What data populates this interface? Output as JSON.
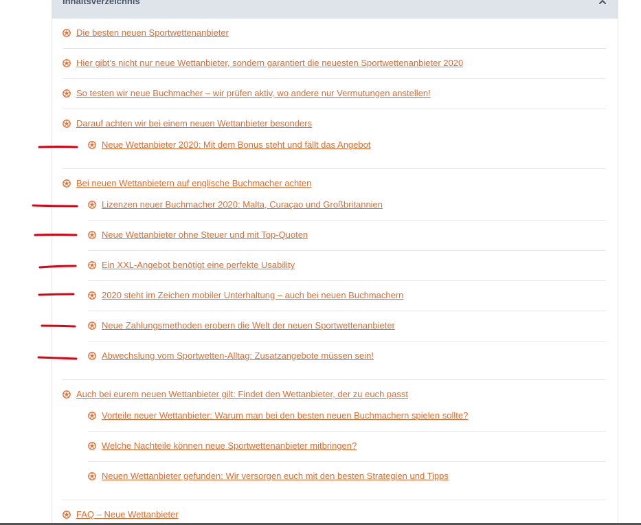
{
  "toc": {
    "title": "Inhaltsverzeichnis",
    "items": [
      {
        "label": "Die besten neuen Sportwettenanbieter"
      },
      {
        "label": "Hier gibt’s nicht nur neue Wettanbieter, sondern garantiert die neuesten Sportwettenanbieter 2020"
      },
      {
        "label": "So testen wir neue Buchmacher – wir prüfen aktiv, wo andere nur Vermutungen anstellen!"
      },
      {
        "label": "Darauf achten wir bei einem neuen Wettanbieter besonders",
        "children": [
          {
            "label": "Neue Wettanbieter 2020: Mit dem Bonus steht und fällt das Angebot"
          }
        ]
      },
      {
        "label": "Bei neuen Wettanbietern auf englische Buchmacher achten",
        "children": [
          {
            "label": "Lizenzen neuer Buchmacher 2020: Malta, Curaçao und Großbritannien"
          },
          {
            "label": "Neue Wettanbieter ohne Steuer und mit Top-Quoten"
          },
          {
            "label": "Ein XXL-Angebot benötigt eine perfekte Usability"
          },
          {
            "label": "2020 steht im Zeichen mobiler Unterhaltung – auch bei neuen Buchmachern"
          },
          {
            "label": "Neue Zahlungsmethoden erobern die Welt der neuen Sportwettenanbieter"
          },
          {
            "label": "Abwechslung vom Sportwetten-Alltag: Zusatzangebote müssen sein!"
          }
        ]
      },
      {
        "label": "Auch bei eurem neuen Wettanbieter gilt: Findet den Wettanbieter, der zu euch passt",
        "children": [
          {
            "label": "Vorteile neuer Wettanbieter: Warum man bei den besten neuen Buchmachern spielen sollte?"
          },
          {
            "label": "Welche Nachteile können neue Sportwettenanbieter mitbringen?"
          },
          {
            "label": "Neuen Wettanbieter gefunden: Wir versorgen euch mit den besten Strategien und Tipps"
          }
        ]
      },
      {
        "label": "FAQ – Neue Wettanbieter"
      }
    ]
  },
  "colors": {
    "link": "#e86a2c",
    "header_bg": "#dfe4ea",
    "title": "#4a5668",
    "annotation": "#e0000f"
  },
  "icons": {
    "bullet": "football-bullet-icon",
    "toggle": "chevron-up-icon"
  }
}
